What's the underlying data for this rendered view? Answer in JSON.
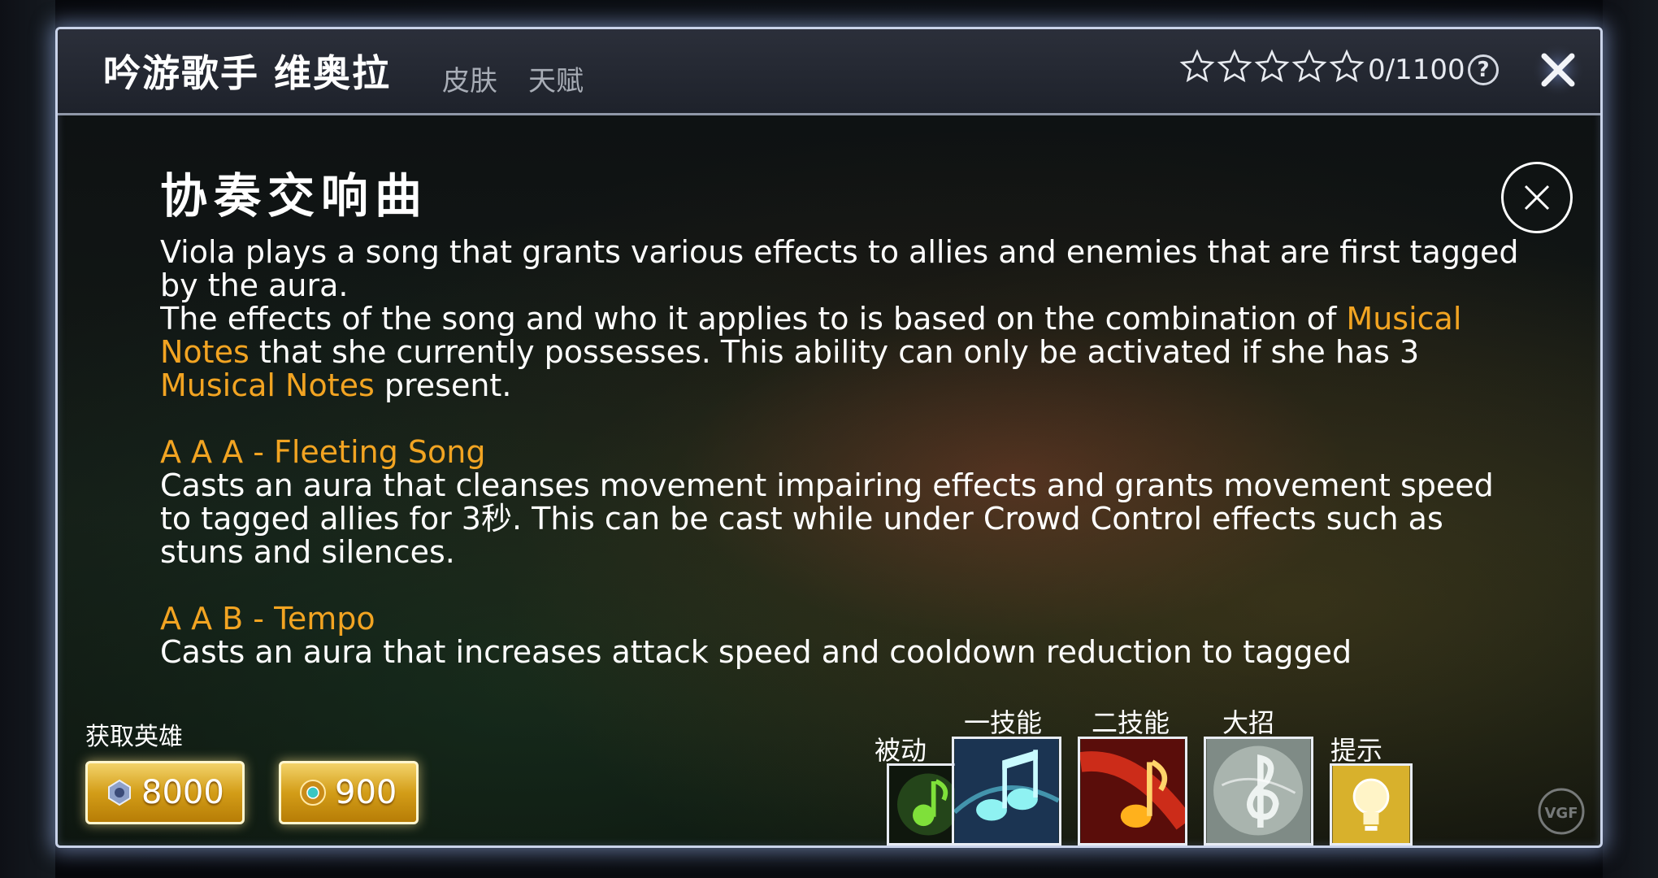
{
  "header": {
    "hero_name": "吟游歌手 维奥拉",
    "tabs": [
      {
        "label": "皮肤"
      },
      {
        "label": "天赋"
      }
    ],
    "mastery_progress": "0/1100",
    "stars_total": 5,
    "stars_filled": 0,
    "help_label": "?"
  },
  "ability": {
    "title": "协奏交响曲",
    "para1": "Viola plays a song that grants various effects to allies and enemies that are first tagged by the aura.",
    "para2_a": "The effects of the song and who it applies to is based on the combination of ",
    "para2_hl1": "Musical Notes",
    "para2_b": " that she currently possesses. This ability can only be activated if she has 3 ",
    "para2_hl2": "Musical Notes",
    "para2_c": " present.",
    "section1_title": "A A A - Fleeting Song",
    "section1_text": "Casts an aura that cleanses movement impairing effects and grants movement speed to tagged allies for 3秒. This can be cast while under Crowd Control effects such as stuns and silences.",
    "section2_title": "A A B - Tempo",
    "section2_text": "Casts an aura that increases attack speed and cooldown reduction to tagged"
  },
  "acquire": {
    "label": "获取英雄",
    "glory_price": "8000",
    "ice_price": "900"
  },
  "skills": [
    {
      "label": "被动",
      "icon": "green-music-note-icon"
    },
    {
      "label": "一技能",
      "icon": "teal-double-note-icon"
    },
    {
      "label": "二技能",
      "icon": "red-music-note-icon"
    },
    {
      "label": "大招",
      "icon": "silver-treble-clef-icon"
    },
    {
      "label": "提示",
      "icon": "lightbulb-icon"
    }
  ],
  "colors": {
    "highlight": "#f2a422",
    "panel_border": "#c9d3ea",
    "gold_button": "#d39d18"
  }
}
